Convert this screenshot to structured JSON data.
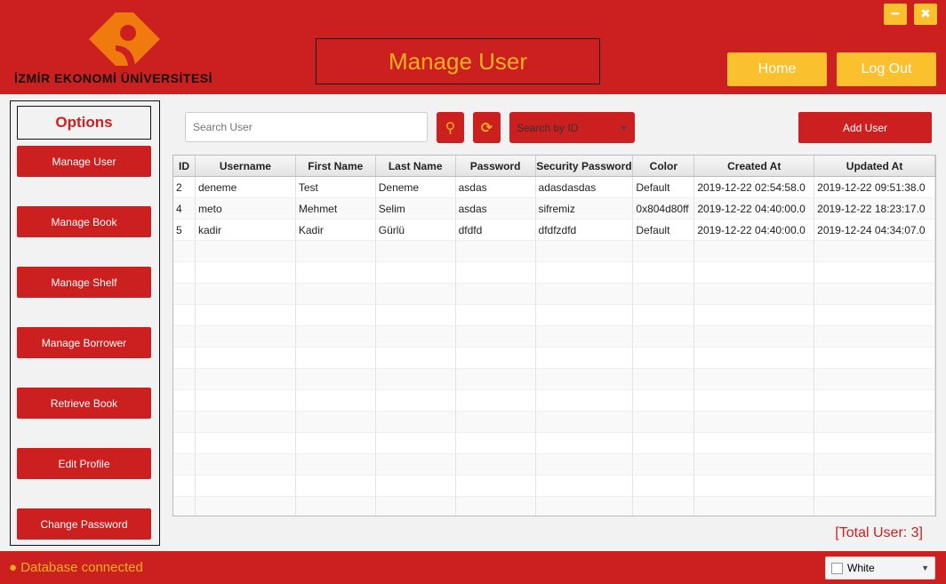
{
  "header": {
    "logo_text": "İZMİR EKONOMİ ÜNİVERSİTESİ",
    "title": "Manage User",
    "home": "Home",
    "logout": "Log Out",
    "minimize": "━",
    "close": "✖"
  },
  "sidebar": {
    "title": "Options",
    "items": [
      {
        "label": "Manage User"
      },
      {
        "label": "Manage Book"
      },
      {
        "label": "Manage Shelf"
      },
      {
        "label": "Manage Borrower"
      },
      {
        "label": "Retrieve Book"
      },
      {
        "label": "Edit Profile"
      },
      {
        "label": "Change Password"
      }
    ]
  },
  "toolbar": {
    "search_placeholder": "Search User",
    "search_icon": "⚲",
    "refresh_icon": "⟳",
    "search_by": "Search by ID",
    "add_user": "Add User"
  },
  "table": {
    "columns": [
      "ID",
      "Username",
      "First Name",
      "Last Name",
      "Password",
      "Security Password",
      "Color",
      "Created At",
      "Updated At"
    ],
    "rows": [
      [
        "2",
        "deneme",
        "Test",
        "Deneme",
        "asdas",
        "adasdasdas",
        "Default",
        "2019-12-22 02:54:58.0",
        "2019-12-22 09:51:38.0"
      ],
      [
        "4",
        "meto",
        "Mehmet",
        "Selim",
        "asdas",
        "sifremiz",
        "0x804d80ff",
        "2019-12-22 04:40:00.0",
        "2019-12-22 18:23:17.0"
      ],
      [
        "5",
        "kadir",
        "Kadir",
        "Gürlü",
        "dfdfd",
        "dfdfzdfd",
        "Default",
        "2019-12-22 04:40:00.0",
        "2019-12-24 04:34:07.0"
      ]
    ]
  },
  "total": "[Total User: 3]",
  "footer": {
    "status": "● Database connected",
    "theme": "White"
  },
  "colors": {
    "primary": "#cc1f1f",
    "accent": "#fbc02d"
  }
}
